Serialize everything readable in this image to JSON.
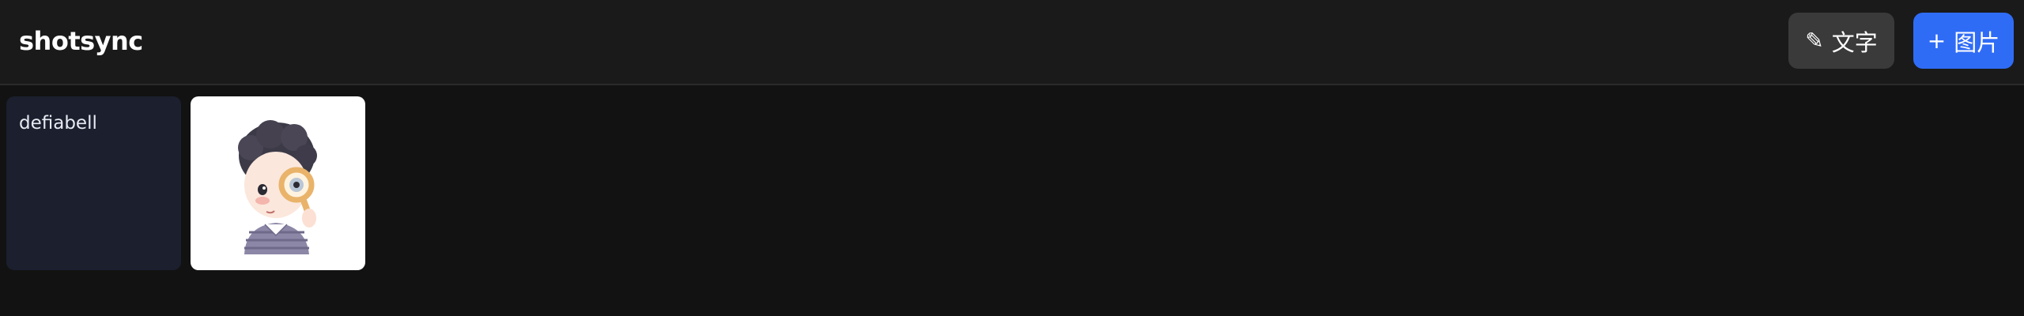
{
  "header": {
    "title": "shotsync",
    "text_button": {
      "icon": "pencil-icon",
      "glyph": "✎",
      "label": "文字"
    },
    "image_button": {
      "icon": "plus-icon",
      "glyph": "+",
      "label": "图片"
    }
  },
  "items": [
    {
      "type": "text",
      "content": "defiabell"
    },
    {
      "type": "image",
      "subject": "cartoon-boy-with-magnifier-illustration"
    }
  ],
  "colors": {
    "background": "#121212",
    "header_background": "#1a1a1a",
    "text_button": "#3a3a3a",
    "accent": "#2f6cf6",
    "text_card": "#1b1f2e",
    "image_card": "#ffffff"
  }
}
